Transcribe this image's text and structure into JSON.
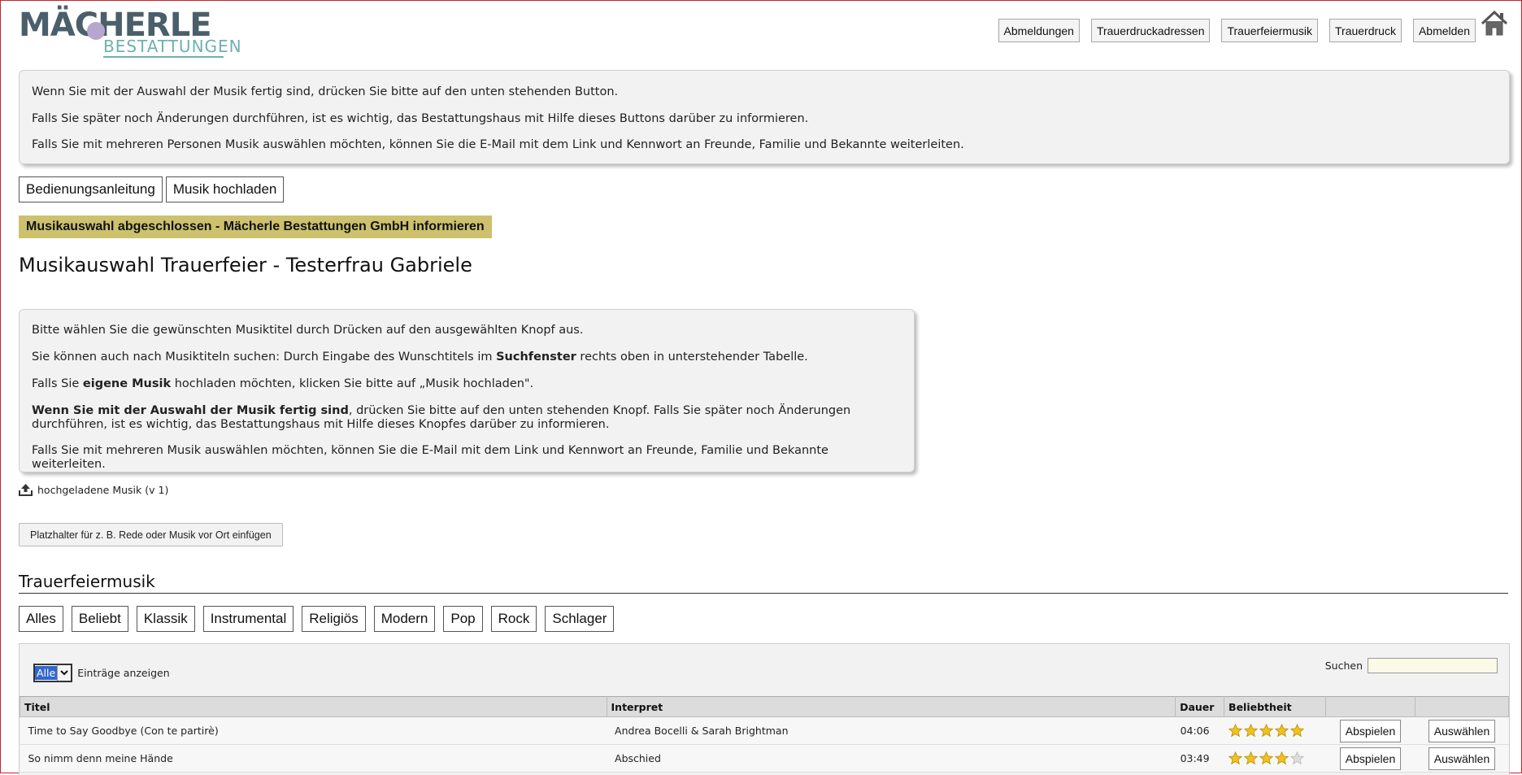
{
  "logo": {
    "main": "MÄCHERLE",
    "sub": "BESTATTUNGEN"
  },
  "nav": [
    {
      "label": "Abmeldungen"
    },
    {
      "label": "Trauerdruckadressen"
    },
    {
      "label": "Trauerfeiermusik"
    },
    {
      "label": "Trauerdruck"
    },
    {
      "label": "Abmelden"
    }
  ],
  "info_box_top": [
    "Wenn Sie mit der Auswahl der Musik fertig sind, drücken Sie bitte auf den unten stehenden Button.",
    "Falls Sie später noch Änderungen durchführen, ist es wichtig, das Bestattungshaus mit Hilfe dieses Buttons darüber zu informieren.",
    "Falls Sie mit mehreren Personen Musik auswählen möchten, können Sie die E-Mail mit dem Link und Kennwort an Freunde, Familie und Bekannte weiterleiten."
  ],
  "buttons": {
    "manual": "Bedienungsanleitung",
    "upload": "Musik hochladen"
  },
  "notify_button": "Musikauswahl abgeschlossen - Mächerle Bestattungen GmbH informieren",
  "page_title": "Musikauswahl Trauerfeier - Testerfrau Gabriele",
  "info_box_main": {
    "p1": "Bitte wählen Sie die gewünschten Musiktitel durch Drücken auf den ausgewählten Knopf aus.",
    "p2_pre": "Sie können auch nach Musiktiteln suchen: Durch Eingabe des Wunschtitels im ",
    "p2_bold": "Suchfenster",
    "p2_post": " rechts oben in unterstehender Tabelle.",
    "p3_pre": "Falls Sie ",
    "p3_bold": "eigene Musik",
    "p3_post": " hochladen möchten, klicken Sie bitte auf „Musik hochladen\".",
    "p4_bold": "Wenn Sie mit der Auswahl der Musik fertig sind",
    "p4_post": ", drücken Sie bitte auf den unten stehenden Knopf. Falls Sie später noch Änderungen durchführen, ist es wichtig, das Bestattungshaus mit Hilfe dieses Knopfes darüber zu informieren.",
    "p5": "Falls Sie mit mehreren Musik auswählen möchten, können Sie die E-Mail mit dem Link und Kennwort an Freunde, Familie und Bekannte weiterleiten."
  },
  "uploaded_music": "hochgeladene Musik (v 1)",
  "placeholder_button": "Platzhalter für z. B. Rede oder Musik vor Ort einfügen",
  "section_title": "Trauerfeiermusik",
  "filters": [
    "Alles",
    "Beliebt",
    "Klassik",
    "Instrumental",
    "Religiös",
    "Modern",
    "Pop",
    "Rock",
    "Schlager"
  ],
  "table": {
    "length_value": "Alle",
    "length_label": "Einträge anzeigen",
    "search_label": "Suchen",
    "search_value": "",
    "columns": [
      "Titel",
      "Interpret",
      "Dauer",
      "Beliebtheit",
      "",
      ""
    ],
    "rows": [
      {
        "title": "Time to Say Goodbye (Con te partirè)",
        "artist": "Andrea Bocelli & Sarah Brightman",
        "duration": "04:06",
        "rating": 5,
        "play": "Abspielen",
        "select": "Auswählen"
      },
      {
        "title": "So nimm denn meine Hände",
        "artist": "Abschied",
        "duration": "03:49",
        "rating": 4,
        "play": "Abspielen",
        "select": "Auswählen"
      }
    ]
  },
  "colors": {
    "notify_bg": "#cdc16e",
    "logo_dark": "#4a5f6a",
    "logo_teal": "#6fb0b0",
    "logo_dot": "#b7a6cf",
    "star_on": "#f2c21b",
    "star_off": "#dddddd",
    "border_red": "#c0282d"
  },
  "icons": {
    "home": "home-icon",
    "upload": "upload-icon",
    "star": "star-icon",
    "dropdown": "chevron-down-icon"
  }
}
